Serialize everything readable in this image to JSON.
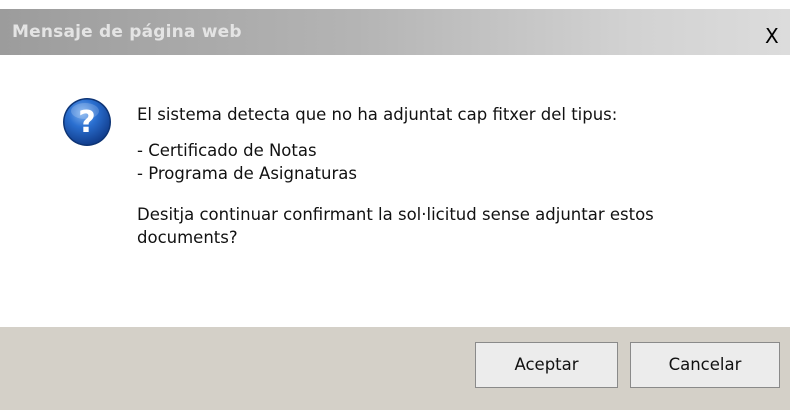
{
  "dialog": {
    "title": "Mensaje de página web",
    "close_label": "X",
    "icon": "question-icon",
    "message": {
      "intro": "El sistema detecta que no ha adjuntat cap fitxer del tipus:",
      "items": [
        "- Certificado de Notas",
        "- Programa de Asignaturas"
      ],
      "question_line1": "Desitja continuar confirmant la sol·licitud sense adjuntar estos",
      "question_line2": "documents?"
    },
    "buttons": {
      "ok_label": "Aceptar",
      "cancel_label": "Cancelar"
    }
  },
  "colors": {
    "icon_blue": "#1f5fb8",
    "footer": "#d4d0c8",
    "title_text": "#e4e4e4"
  }
}
